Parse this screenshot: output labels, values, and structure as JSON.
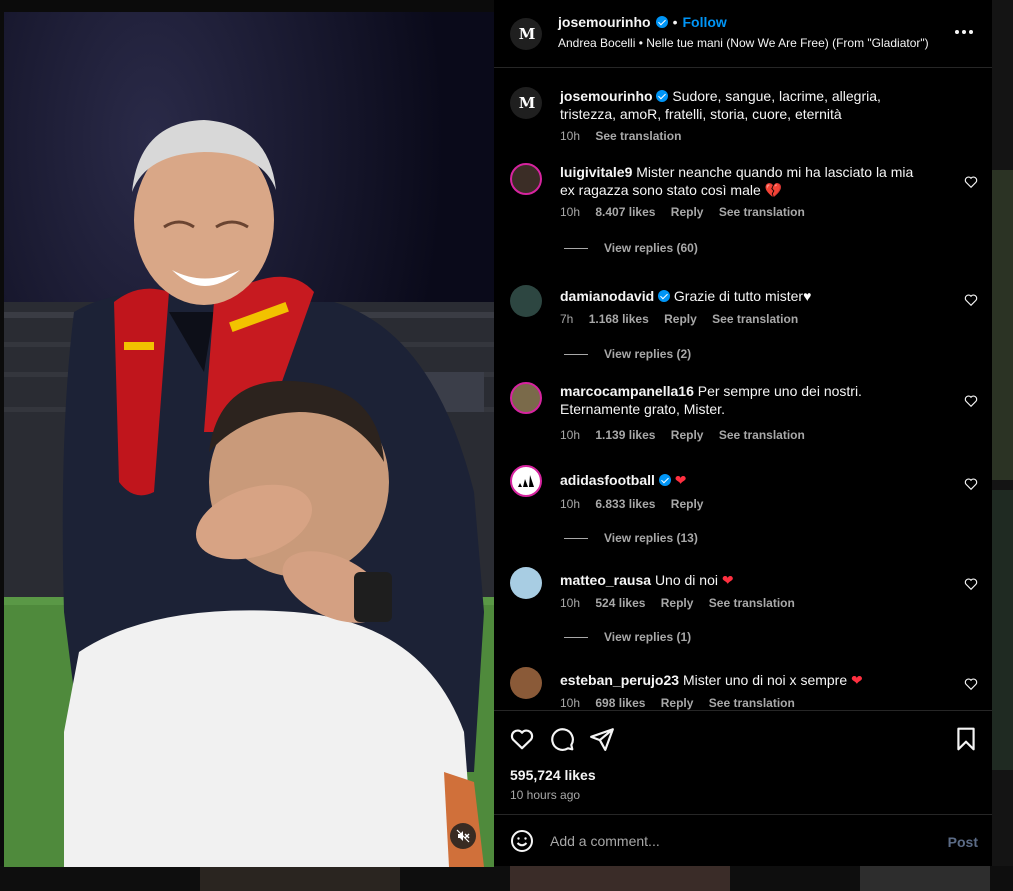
{
  "post": {
    "username": "josemourinho",
    "follow_label": "Follow",
    "separator": "•",
    "song": "Andrea Bocelli • Nelle tue mani (Now We Are Free) (From \"Gladiator\")",
    "caption": {
      "username": "josemourinho",
      "text": "Sudore, sangue, lacrime, allegria, tristezza, amoR, fratelli, storia, cuore, eternità",
      "time": "10h",
      "see_translation": "See translation"
    }
  },
  "comments": [
    {
      "username": "luigivitale9",
      "text": "Mister neanche quando mi ha lasciato la mia ex ragazza sono stato così male",
      "emoji": "💔",
      "time": "10h",
      "likes": "8.407 likes",
      "reply": "Reply",
      "see_translation": "See translation",
      "view_replies": "View replies (60)"
    },
    {
      "username": "damianodavid",
      "verified": true,
      "text": "Grazie di tutto mister",
      "emoji": "♥",
      "time": "7h",
      "likes": "1.168 likes",
      "reply": "Reply",
      "see_translation": "See translation",
      "view_replies": "View replies (2)"
    },
    {
      "username": "marcocampanella16",
      "text": "Per sempre uno dei nostri. Eternamente grato, Mister.",
      "time": "10h",
      "likes": "1.139 likes",
      "reply": "Reply",
      "see_translation": "See translation"
    },
    {
      "username": "adidasfootball",
      "verified": true,
      "text": "",
      "emoji": "❤",
      "time": "10h",
      "likes": "6.833 likes",
      "reply": "Reply",
      "view_replies": "View replies (13)"
    },
    {
      "username": "matteo_rausa",
      "text": "Uno di noi",
      "emoji": "❤",
      "time": "10h",
      "likes": "524 likes",
      "reply": "Reply",
      "see_translation": "See translation",
      "view_replies": "View replies (1)"
    },
    {
      "username": "esteban_perujo23",
      "text": "Mister uno di noi x sempre",
      "emoji": "❤",
      "time": "10h",
      "likes": "698 likes",
      "reply": "Reply",
      "see_translation": "See translation"
    }
  ],
  "footer": {
    "likes": "595,724 likes",
    "time": "10 hours ago",
    "comment_placeholder": "Add a comment...",
    "post_label": "Post"
  },
  "colors": {
    "accent": "#0095f6",
    "heart": "#ff3040",
    "background": "#000000",
    "muted_text": "#a8a8a8"
  },
  "icons": [
    "verified-badge-icon",
    "more-options-icon",
    "heart-icon",
    "comment-icon",
    "share-icon",
    "bookmark-icon",
    "emoji-icon",
    "mute-icon"
  ]
}
